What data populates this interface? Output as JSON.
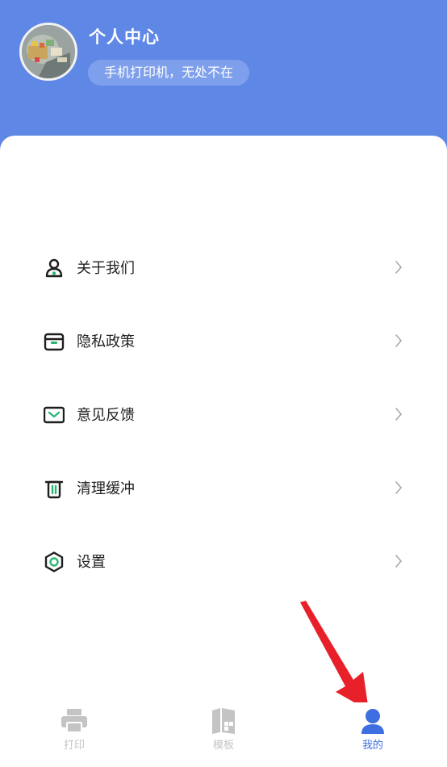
{
  "header": {
    "title": "个人中心",
    "slogan": "手机打印机，无处不在",
    "background_color": "#5e87e6"
  },
  "menu": {
    "items": [
      {
        "label": "关于我们",
        "icon": "user-icon"
      },
      {
        "label": "隐私政策",
        "icon": "box-icon"
      },
      {
        "label": "意见反馈",
        "icon": "mail-icon"
      },
      {
        "label": "清理缓冲",
        "icon": "trash-icon"
      },
      {
        "label": "设置",
        "icon": "gear-icon"
      }
    ],
    "icon_accent_color": "#2bb673",
    "chevron_icon": "chevron-right-icon"
  },
  "tabbar": {
    "tabs": [
      {
        "label": "打印",
        "icon": "printer-icon",
        "active": false
      },
      {
        "label": "模板",
        "icon": "template-icon",
        "active": false
      },
      {
        "label": "我的",
        "icon": "person-icon",
        "active": true
      }
    ],
    "active_color": "#3d6fe0",
    "inactive_color": "#c4c4c4"
  },
  "annotation": {
    "icon": "red-arrow-icon",
    "color": "#e8202a"
  }
}
